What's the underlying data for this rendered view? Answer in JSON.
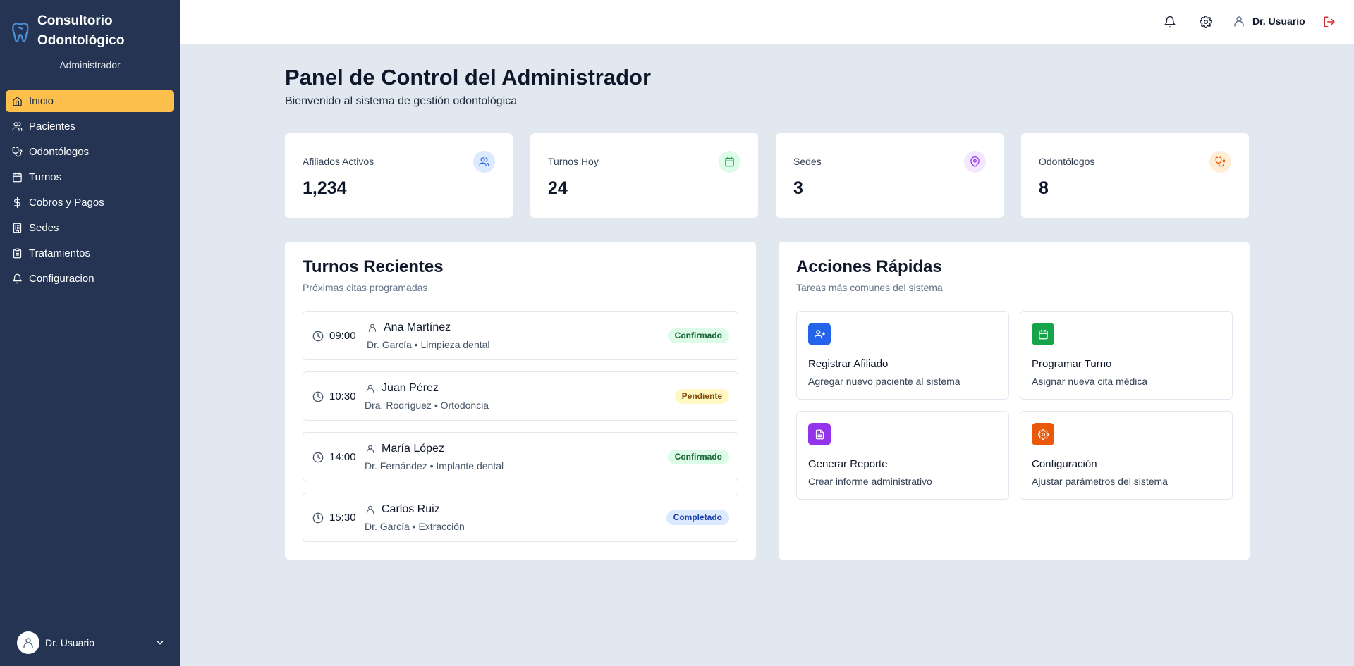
{
  "sidebar": {
    "brand_title": "Consultorio Odontológico",
    "role": "Administrador",
    "items": [
      {
        "label": "Inicio",
        "icon": "home-icon",
        "active": true
      },
      {
        "label": "Pacientes",
        "icon": "users-icon"
      },
      {
        "label": "Odontólogos",
        "icon": "stethoscope-icon"
      },
      {
        "label": "Turnos",
        "icon": "calendar-icon"
      },
      {
        "label": "Cobros y Pagos",
        "icon": "dollar-icon"
      },
      {
        "label": "Sedes",
        "icon": "building-icon"
      },
      {
        "label": "Tratamientos",
        "icon": "clipboard-icon"
      },
      {
        "label": "Configuracion",
        "icon": "bell-icon"
      }
    ],
    "user_name": "Dr. Usuario"
  },
  "header": {
    "user_name": "Dr. Usuario",
    "icons": [
      "bell-icon",
      "gear-icon",
      "user-icon",
      "logout-icon"
    ]
  },
  "main": {
    "title": "Panel de Control del Administrador",
    "subtitle": "Bienvenido al sistema de gestión odontológica",
    "stats": [
      {
        "label": "Afiliados Activos",
        "value": "1,234",
        "icon": "users-icon",
        "color": "#2563eb",
        "bg": "#dbeafe"
      },
      {
        "label": "Turnos Hoy",
        "value": "24",
        "icon": "calendar-icon",
        "color": "#16a34a",
        "bg": "#dcfce7"
      },
      {
        "label": "Sedes",
        "value": "3",
        "icon": "map-pin-icon",
        "color": "#9333ea",
        "bg": "#f3e8ff"
      },
      {
        "label": "Odontólogos",
        "value": "8",
        "icon": "stethoscope-icon",
        "color": "#ea580c",
        "bg": "#ffedd5"
      }
    ],
    "recent": {
      "title": "Turnos Recientes",
      "subtitle": "Próximas citas programadas",
      "items": [
        {
          "time": "09:00",
          "name": "Ana Martínez",
          "detail": "Dr. García • Limpieza dental",
          "status": "Confirmado"
        },
        {
          "time": "10:30",
          "name": "Juan Pérez",
          "detail": "Dra. Rodríguez • Ortodoncia",
          "status": "Pendiente"
        },
        {
          "time": "14:00",
          "name": "María López",
          "detail": "Dr. Fernández • Implante dental",
          "status": "Confirmado"
        },
        {
          "time": "15:30",
          "name": "Carlos Ruiz",
          "detail": "Dr. García • Extracción",
          "status": "Completado"
        }
      ]
    },
    "actions": {
      "title": "Acciones Rápidas",
      "subtitle": "Tareas más comunes del sistema",
      "items": [
        {
          "title": "Registrar Afiliado",
          "desc": "Agregar nuevo paciente al sistema",
          "icon": "user-plus-icon",
          "color": "#2563eb"
        },
        {
          "title": "Programar Turno",
          "desc": "Asignar nueva cita médica",
          "icon": "calendar-icon",
          "color": "#16a34a"
        },
        {
          "title": "Generar Reporte",
          "desc": "Crear informe administrativo",
          "icon": "file-icon",
          "color": "#9333ea"
        },
        {
          "title": "Configuración",
          "desc": "Ajustar parámetros del sistema",
          "icon": "gear-icon",
          "color": "#ea580c"
        }
      ]
    }
  }
}
